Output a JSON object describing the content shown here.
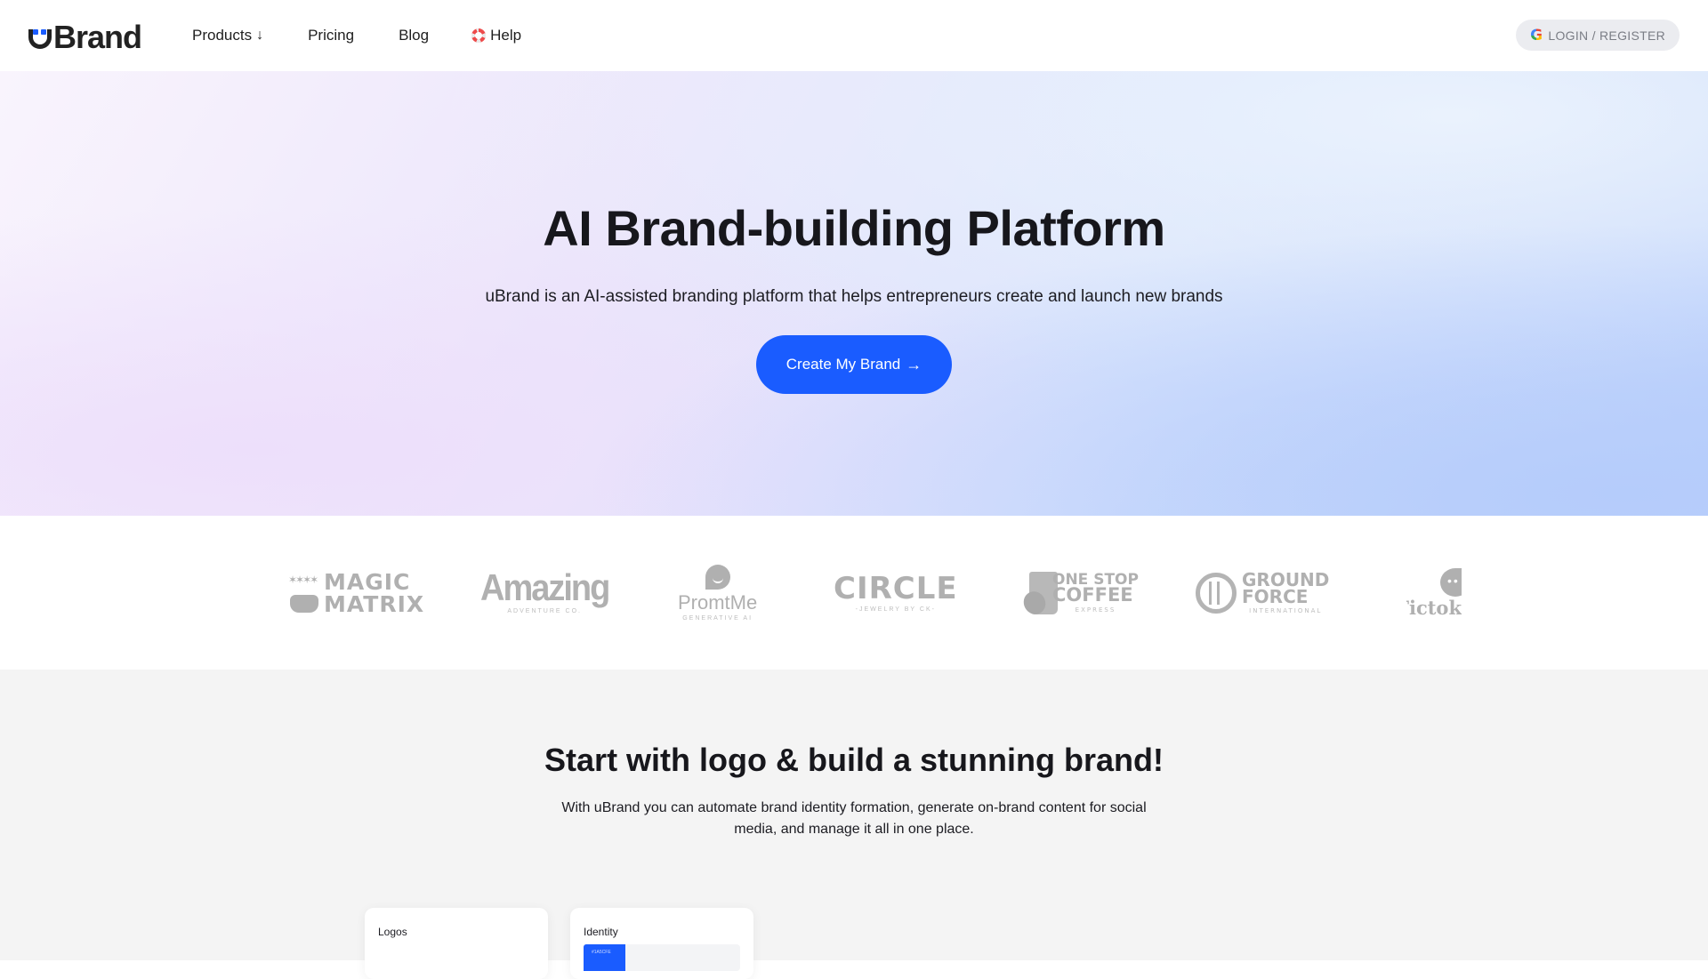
{
  "header": {
    "brand": "Brand",
    "nav": [
      {
        "label": "Products",
        "icon": "arrow-down-icon",
        "icon_glyph": "↓"
      },
      {
        "label": "Pricing"
      },
      {
        "label": "Blog"
      },
      {
        "label": "Help",
        "icon": "lifebuoy-icon"
      }
    ],
    "login": {
      "label": "LOGIN / REGISTER",
      "icon": "google-icon",
      "icon_glyph": "G"
    }
  },
  "hero": {
    "title": "AI Brand-building Platform",
    "subtitle": "uBrand is an AI-assisted branding platform that helps entrepreneurs create and launch new brands",
    "cta": {
      "label": "Create My Brand",
      "icon": "arrow-right-icon",
      "icon_glyph": "→"
    }
  },
  "logo_strip": [
    {
      "name": "MAGIC MATRIX",
      "line1": "MAGIC",
      "line2": "MATRIX"
    },
    {
      "name": "Amazing",
      "tagline": "ADVENTURE CO."
    },
    {
      "name": "PromtMe",
      "tagline": "GENERATIVE AI"
    },
    {
      "name": "CIRCLE",
      "tagline": "-JEWELRY BY CK-"
    },
    {
      "name": "ONE STOP COFFEE",
      "line1": "ONE STOP",
      "line2": "COFFEE",
      "tagline": "EXPRESS"
    },
    {
      "name": "GROUND FORCE",
      "line1": "GROUND",
      "line2": "FORCE",
      "tagline": "INTERNATIONAL"
    },
    {
      "name": "Tictok"
    }
  ],
  "section2": {
    "title": "Start with logo & build a stunning brand!",
    "subtitle": "With uBrand you can automate brand identity formation, generate on-brand content for social media, and manage it all in one place.",
    "cards": [
      {
        "title": "Logos"
      },
      {
        "title": "Identity",
        "swatch_hex": "#1A5CFE"
      }
    ]
  },
  "colors": {
    "accent": "#1a5cff",
    "text": "#17171c",
    "section_bg": "#f4f4f4"
  }
}
